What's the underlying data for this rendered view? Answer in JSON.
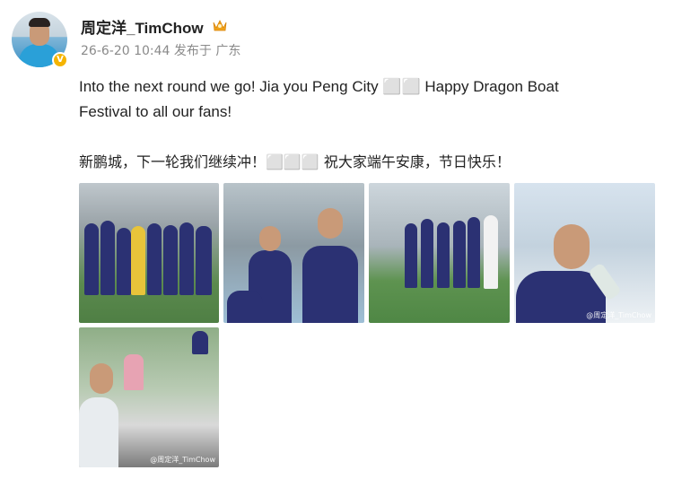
{
  "author": {
    "name": "周定洋_TimChow",
    "badge_icon": "crown-icon",
    "verified_icon": "verified-v-icon",
    "verified_color": "#f5b400"
  },
  "post_meta": {
    "timestamp_and_location": "26-6-20 10:44 发布于 广东"
  },
  "post_text": {
    "english_line1": "Into the next round we go! Jia you Peng City ⬜⬜ Happy Dragon Boat",
    "english_line2": "Festival to all our fans!",
    "chinese_line": "新鹏城，下一轮我们继续冲！⬜⬜⬜ 祝大家端午安康，节日快乐！"
  },
  "photos": [
    {
      "description_icon": "team-photo",
      "watermark": ""
    },
    {
      "description_icon": "player-with-kids",
      "watermark": ""
    },
    {
      "description_icon": "team-on-pitch",
      "watermark": ""
    },
    {
      "description_icon": "player-drinking",
      "watermark": "@周定洋_TimChow"
    },
    {
      "description_icon": "player-in-stands",
      "watermark": "@周定洋_TimChow"
    }
  ]
}
